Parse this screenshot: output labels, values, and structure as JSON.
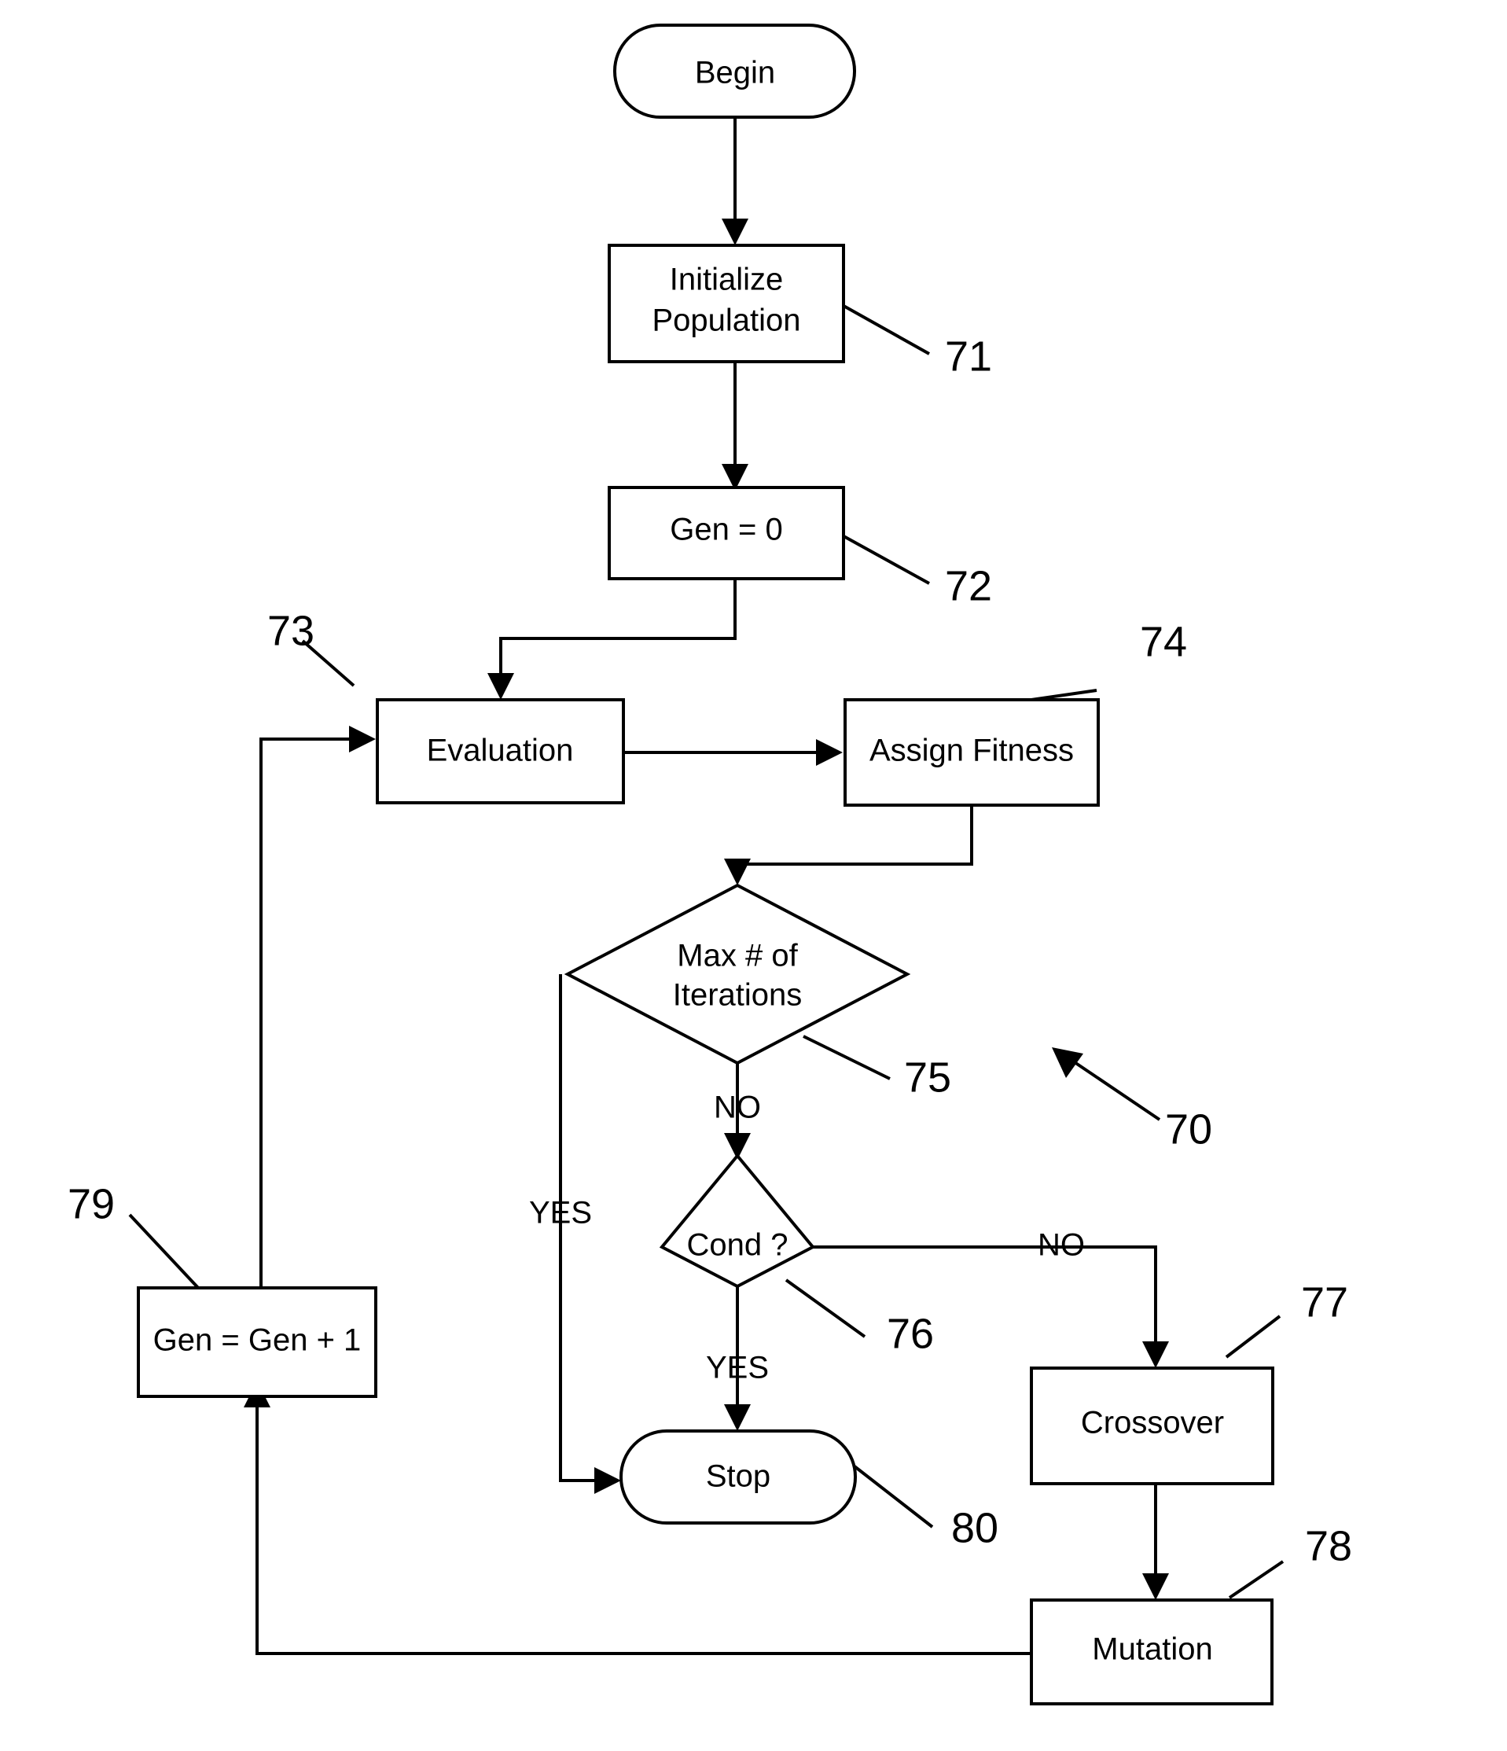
{
  "figure": {
    "type": "flowchart",
    "title": "Genetic Algorithm Flowchart",
    "overall_ref": "70",
    "nodes": [
      {
        "id": "begin",
        "label": "Begin",
        "shape": "stadium",
        "ref": ""
      },
      {
        "id": "init",
        "label_line1": "Initialize",
        "label_line2": "Population",
        "shape": "rect",
        "ref": "71"
      },
      {
        "id": "gen0",
        "label": "Gen = 0",
        "shape": "rect",
        "ref": "72"
      },
      {
        "id": "evaluation",
        "label": "Evaluation",
        "shape": "rect",
        "ref": "73"
      },
      {
        "id": "fitness",
        "label": "Assign Fitness",
        "shape": "rect",
        "ref": "74"
      },
      {
        "id": "maxiter",
        "label_line1": "Max # of",
        "label_line2": "Iterations",
        "shape": "diamond",
        "ref": "75"
      },
      {
        "id": "cond",
        "label": "Cond ?",
        "shape": "diamond",
        "ref": "76"
      },
      {
        "id": "crossover",
        "label": "Crossover",
        "shape": "rect",
        "ref": "77"
      },
      {
        "id": "mutation",
        "label": "Mutation",
        "shape": "rect",
        "ref": "78"
      },
      {
        "id": "genincr",
        "label": "Gen = Gen + 1",
        "shape": "rect",
        "ref": "79"
      },
      {
        "id": "stop",
        "label": "Stop",
        "shape": "stadium",
        "ref": "80"
      }
    ],
    "edge_labels": {
      "maxiter_yes": "YES",
      "maxiter_no": "NO",
      "cond_yes": "YES",
      "cond_no": "NO"
    },
    "ref_numbers": {
      "init": "71",
      "gen0": "72",
      "evaluation": "73",
      "fitness": "74",
      "maxiter": "75",
      "cond": "76",
      "crossover": "77",
      "mutation": "78",
      "genincr": "79",
      "stop": "80",
      "overall": "70"
    },
    "colors": {
      "stroke": "#000000",
      "fill": "#ffffff",
      "text": "#000000"
    }
  }
}
